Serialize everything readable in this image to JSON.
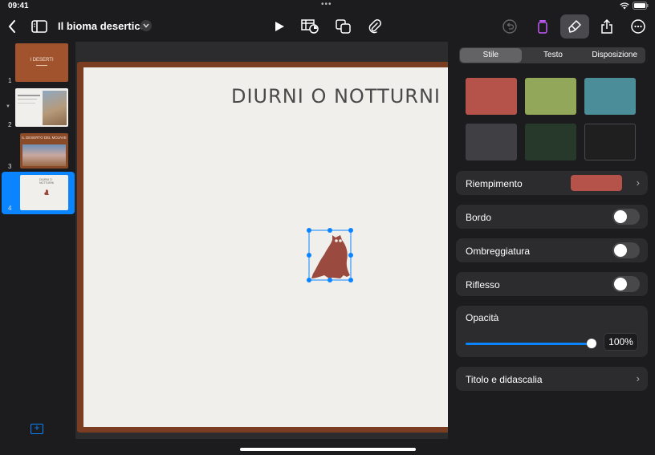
{
  "status": {
    "time": "09:41"
  },
  "toolbar": {
    "title": "Il bioma desertico"
  },
  "navigator": {
    "slides": [
      {
        "number": "1",
        "title": "I DESERTI"
      },
      {
        "number": "2",
        "title": ""
      },
      {
        "number": "3",
        "title": "IL DESERTO DEL MOJAVE"
      },
      {
        "number": "4",
        "title": "DIURNI O NOTTURNI"
      }
    ]
  },
  "slide": {
    "title": "DIURNI O NOTTURNI"
  },
  "inspector": {
    "tabs": [
      "Stile",
      "Testo",
      "Disposizione"
    ],
    "swatches": [
      "#b5534b",
      "#93a75a",
      "#4b8d98",
      "#3f3f44",
      "#26392a",
      "#1f1f20"
    ],
    "fill_label": "Riempimento",
    "fill_color": "#b5534b",
    "border_label": "Bordo",
    "shadow_label": "Ombreggiatura",
    "reflection_label": "Riflesso",
    "opacity_label": "Opacità",
    "opacity_value": "100%",
    "caption_label": "Titolo e didascalia"
  },
  "colors": {
    "accent": "#0a84ff",
    "slide_border": "#7a3d22",
    "owl": "#9a4a3f"
  }
}
